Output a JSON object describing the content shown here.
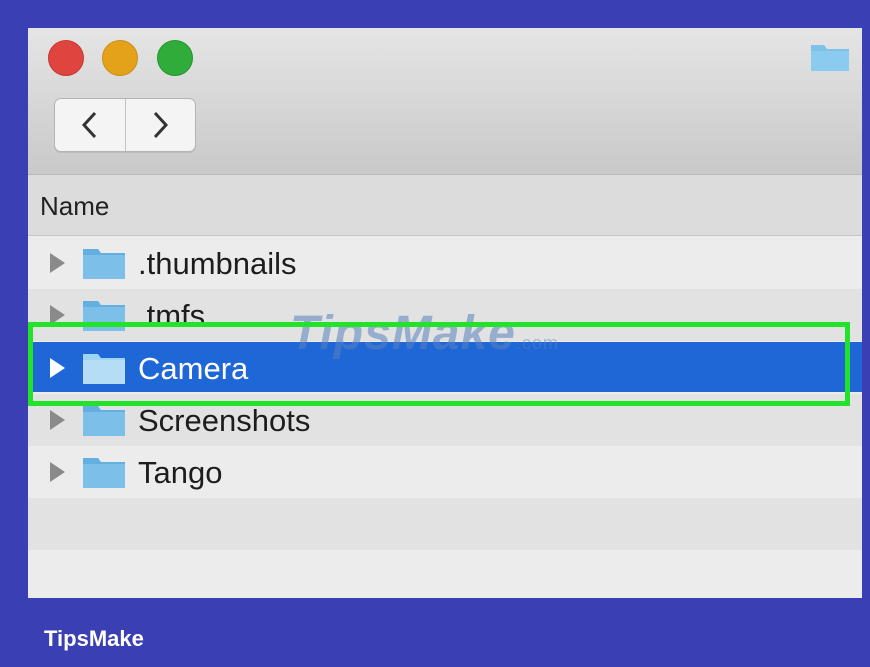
{
  "window": {
    "traffic_lights": [
      {
        "name": "close",
        "color": "#e0443e"
      },
      {
        "name": "minimize",
        "color": "#e3a21a"
      },
      {
        "name": "zoom",
        "color": "#2fac3a"
      }
    ],
    "title_icon": "folder-icon",
    "nav": {
      "back_icon": "chevron-left-icon",
      "forward_icon": "chevron-right-icon"
    }
  },
  "list": {
    "column_header": "Name",
    "rows": [
      {
        "label": ".thumbnails",
        "icon": "folder-icon",
        "selected": false
      },
      {
        "label": ".tmfs",
        "icon": "folder-icon",
        "selected": false
      },
      {
        "label": "Camera",
        "icon": "folder-icon",
        "selected": true
      },
      {
        "label": "Screenshots",
        "icon": "folder-icon",
        "selected": false
      },
      {
        "label": "Tango",
        "icon": "folder-icon",
        "selected": false
      }
    ]
  },
  "overlay": {
    "watermark_main": "TipsMake",
    "watermark_sub": ".com",
    "highlight_color": "#22e22a"
  },
  "footer": {
    "brand": "TipsMake"
  },
  "colors": {
    "frame_background": "#3a3fb3",
    "selection": "#1f66d6",
    "folder": "#6fb8e4"
  }
}
